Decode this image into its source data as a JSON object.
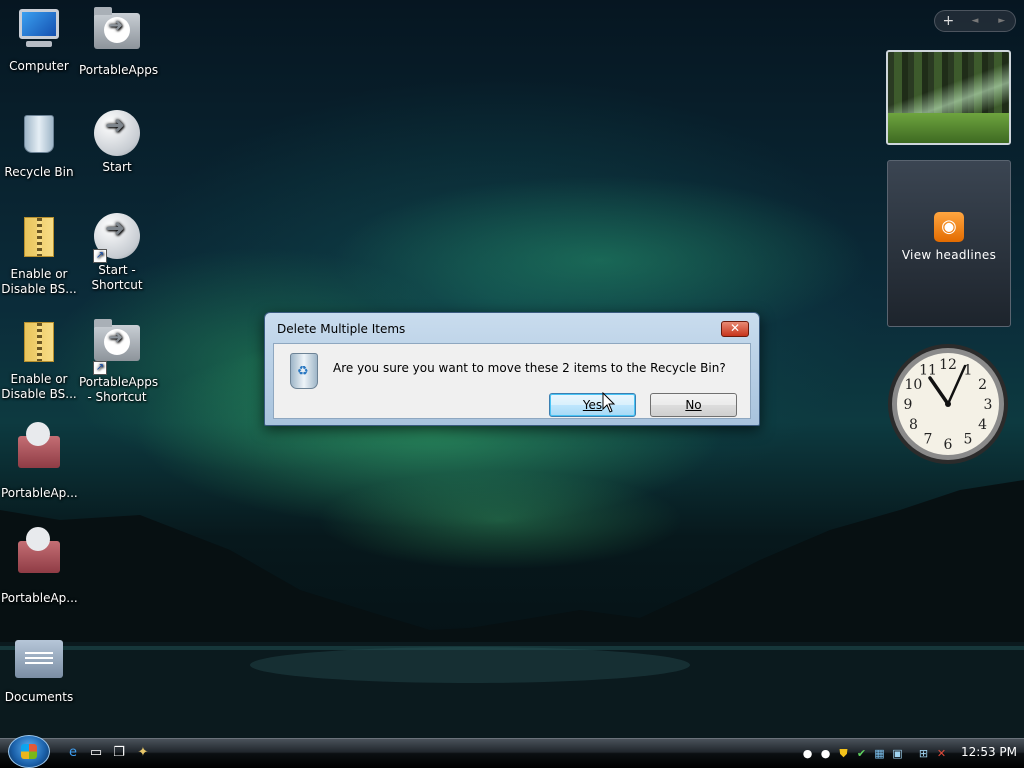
{
  "desktop": {
    "icons": [
      {
        "label": "Computer",
        "icon": "computer-icon"
      },
      {
        "label": "PortableApps",
        "icon": "folder-portableapps-icon"
      },
      {
        "label": "Recycle Bin",
        "icon": "recycle-bin-icon"
      },
      {
        "label": "Start",
        "icon": "portableapps-start-icon"
      },
      {
        "label": "Enable or Disable BS...",
        "icon": "zip-folder-icon"
      },
      {
        "label": "Start - Shortcut",
        "icon": "portableapps-start-shortcut-icon"
      },
      {
        "label": "Enable or Disable BS...",
        "icon": "zip-folder-icon"
      },
      {
        "label": "PortableApps - Shortcut",
        "icon": "folder-portableapps-shortcut-icon"
      },
      {
        "label": "PortableAp...",
        "icon": "portableapps-installer-icon"
      },
      {
        "label": "PortableAp...",
        "icon": "portableapps-installer-icon"
      },
      {
        "label": "Documents",
        "icon": "documents-folder-icon"
      }
    ]
  },
  "sidebar": {
    "add_gadget": "+",
    "prev": "◄",
    "next": "►",
    "feed_label": "View headlines"
  },
  "dialog": {
    "title": "Delete Multiple Items",
    "close": "✕",
    "message": "Are you sure you want to move these 2 items to the Recycle Bin?",
    "yes_label": "Yes",
    "no_label": "No"
  },
  "clock_gadget": {
    "numerals": [
      "12",
      "1",
      "2",
      "3",
      "4",
      "5",
      "6",
      "7",
      "8",
      "9",
      "10",
      "11"
    ]
  },
  "taskbar": {
    "time": "12:53 PM",
    "quick_launch": [
      "internet-explorer-icon",
      "show-desktop-icon",
      "switch-windows-icon",
      "app-icon"
    ],
    "tray": [
      "portableapps-tray-icon",
      "portableapps-tray-icon",
      "security-alert-icon",
      "checkmark-icon",
      "network-icon",
      "display-icon",
      "network-activity-icon",
      "volume-muted-icon"
    ]
  },
  "colors": {
    "dialog_border": "#3a5b80",
    "yes_button_highlight": "#48c4f5",
    "taskbar": "#000000"
  }
}
